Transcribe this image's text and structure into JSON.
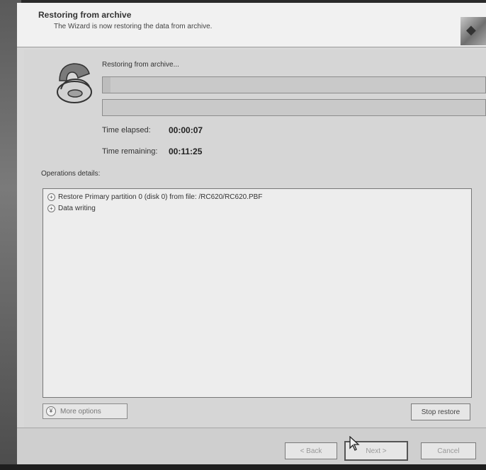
{
  "header": {
    "title": "Restoring from archive",
    "subtitle": "The Wizard is now restoring the data from archive."
  },
  "status": {
    "label": "Restoring from archive...",
    "progress_primary": 0.02,
    "progress_secondary": 0.0
  },
  "time": {
    "elapsed_label": "Time elapsed:",
    "elapsed_value": "00:00:07",
    "remaining_label": "Time remaining:",
    "remaining_value": "00:11:25"
  },
  "operations": {
    "label": "Operations details:",
    "items": [
      {
        "label": "Restore Primary partition 0 (disk 0) from file: /RC620/RC620.PBF",
        "icon": "plus-circle-icon"
      },
      {
        "label": "Data writing",
        "icon": "plus-circle-icon"
      }
    ]
  },
  "buttons": {
    "more_options": "More options",
    "stop_restore": "Stop restore",
    "back": "< Back",
    "next": "Next >",
    "cancel": "Cancel"
  },
  "colors": {
    "window_bg": "#d8d8d8",
    "header_bg": "#f1f1f1",
    "box_bg": "#ededed"
  }
}
